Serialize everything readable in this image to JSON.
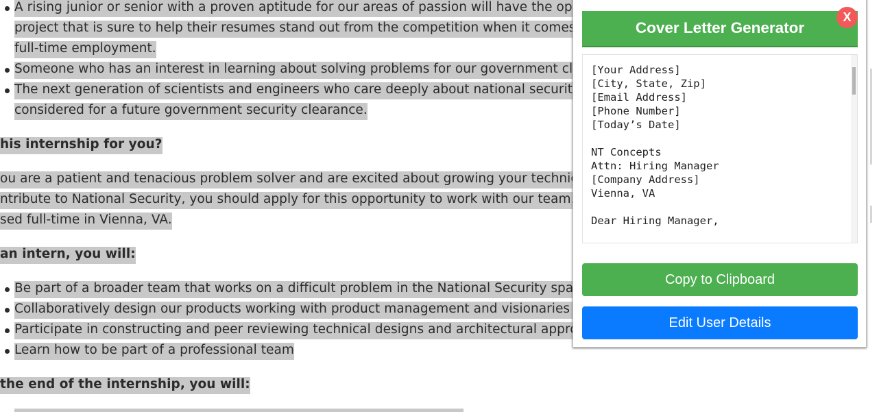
{
  "article": {
    "bullets_top": [
      "A rising junior or senior with a proven aptitude for our areas of passion will have the oppo",
      "project that is sure to help their resumes stand out from the competition when it comes t",
      "full-time employment.",
      "Someone who has an interest in learning about solving problems for our government clie",
      "The next generation of scientists and engineers who care deeply about national security",
      "considered for a future government security clearance."
    ],
    "heading_1": "his internship for you?",
    "para_1": [
      "ou are a patient and tenacious problem solver and are excited about growing your technica",
      "ntribute to National Security, you should apply for this opportunity to work with our team. T",
      "sed full-time in Vienna, VA."
    ],
    "heading_2": "an intern, you will:",
    "bullets_bottom": [
      "Be part of a broader team that works on a difficult problem in the National Security space",
      "Collaboratively design our products working with product management and visionaries i",
      "Participate in constructing and peer reviewing technical designs and architectural appro",
      "Learn how to be part of a professional team"
    ],
    "heading_3": "the end of the internship, you will:"
  },
  "popup": {
    "title": "Cover Letter Generator",
    "close_label": "X",
    "letter_text": "[Your Address]\n[City, State, Zip]\n[Email Address]\n[Phone Number]\n[Today’s Date]\n\nNT Concepts\nAttn: Hiring Manager\n[Company Address]\nVienna, VA\n\nDear Hiring Manager,",
    "copy_button": "Copy to Clipboard",
    "edit_button": "Edit User Details",
    "colors": {
      "title_bg": "#4caf50",
      "close_bg": "#f25a5a",
      "copy_bg": "#4caf50",
      "edit_bg": "#0a7bff"
    }
  }
}
